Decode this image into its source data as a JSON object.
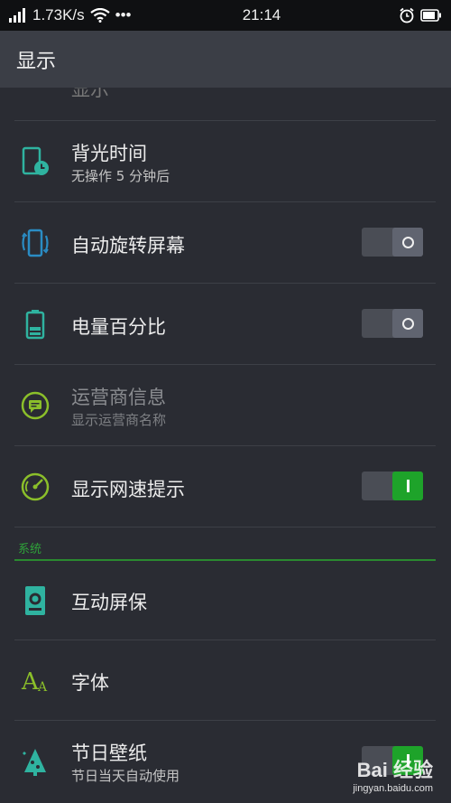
{
  "status_bar": {
    "speed": "1.73K/s",
    "more": "•••",
    "time": "21:14"
  },
  "header": {
    "title": "显示"
  },
  "rows": [
    {
      "title": "显示",
      "sub": ""
    },
    {
      "title": "背光时间",
      "sub": "无操作 5 分钟后"
    },
    {
      "title": "自动旋转屏幕",
      "toggle": "off"
    },
    {
      "title": "电量百分比",
      "toggle": "off"
    },
    {
      "title": "运营商信息",
      "sub": "显示运营商名称",
      "disabled": true
    },
    {
      "title": "显示网速提示",
      "toggle": "on"
    },
    {
      "title": "互动屏保"
    },
    {
      "title": "字体"
    },
    {
      "title": "节日壁纸",
      "sub": "节日当天自动使用",
      "toggle": "on"
    }
  ],
  "section": {
    "label": "系统"
  },
  "colors": {
    "accent": "#1ea32a",
    "background": "#2a2c33",
    "header": "#3b3e46",
    "icon_teal": "#2fb3a0",
    "icon_green": "#8bbf2a"
  },
  "watermark": {
    "brand": "Bai 经验",
    "url": "jingyan.baidu.com"
  }
}
